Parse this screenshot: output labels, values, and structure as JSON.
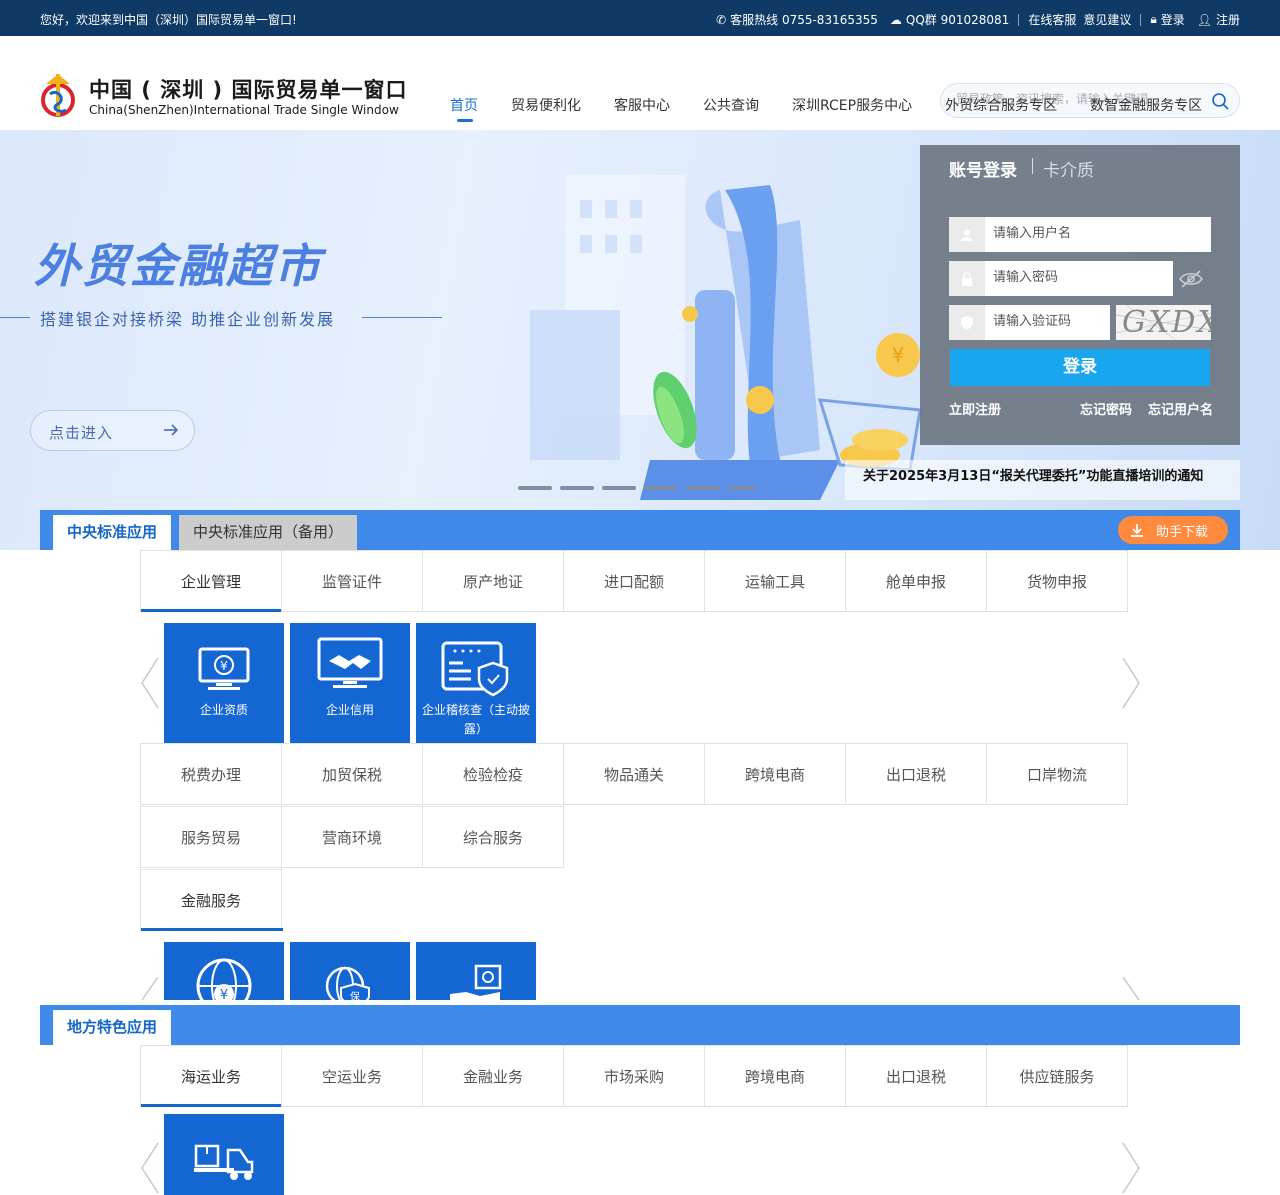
{
  "topbar": {
    "welcome": "您好，欢迎来到中国（深圳）国际贸易单一窗口!",
    "hotline": "客服热线 0755-83165355",
    "qq": "QQ群 901028081",
    "online_service": "在线客服",
    "feedback": "意见建议",
    "login": "登录",
    "register": "注册"
  },
  "header": {
    "brand_cn": "中国 ( 深圳 ) 国际贸易单一窗口",
    "brand_en": "China(ShenZhen)International Trade Single Window",
    "search_placeholder": "贸易政策、资讯搜索，请输入关键词",
    "nav": [
      "首页",
      "贸易便利化",
      "客服中心",
      "公共查询",
      "深圳RCEP服务中心",
      "外贸综合服务专区",
      "数智金融服务专区"
    ]
  },
  "banner": {
    "title": "外贸金融超市",
    "subtitle": "搭建银企对接桥梁   助推企业创新发展",
    "enter_label": "点击进入",
    "notice": "关于2025年3月13日“报关代理委托”功能直播培训的通知"
  },
  "login": {
    "tab_account": "账号登录",
    "tab_card": "卡介质",
    "username_placeholder": "请输入用户名",
    "password_placeholder": "请输入密码",
    "captcha_placeholder": "请输入验证码",
    "captcha_text": "GXDX",
    "submit": "登录",
    "register": "立即注册",
    "forgot_password": "忘记密码",
    "forgot_username": "忘记用户名"
  },
  "central": {
    "tab_main": "中央标准应用",
    "tab_backup": "中央标准应用（备用）",
    "helper": "助手下载",
    "row1": [
      "企业管理",
      "监管证件",
      "原产地证",
      "进口配额",
      "运输工具",
      "舱单申报",
      "货物申报"
    ],
    "tiles1": [
      "企业资质",
      "企业信用",
      "企业稽核查（主动披露）"
    ],
    "row2": [
      "税费办理",
      "加贸保税",
      "检验检疫",
      "物品通关",
      "跨境电商",
      "出口退税",
      "口岸物流"
    ],
    "row3": [
      "服务贸易",
      "营商环境",
      "综合服务"
    ],
    "row4": [
      "金融服务"
    ]
  },
  "local": {
    "tab": "地方特色应用",
    "row1": [
      "海运业务",
      "空运业务",
      "金融业务",
      "市场采购",
      "跨境电商",
      "出口退税",
      "供应链服务"
    ]
  },
  "colors": {
    "topbar": "#103a66",
    "accent": "#1466c8",
    "section_bar": "#3f8ae8",
    "tile": "#1466d2",
    "helper": "#ff8a3d",
    "login_button": "#1aa6ee"
  }
}
